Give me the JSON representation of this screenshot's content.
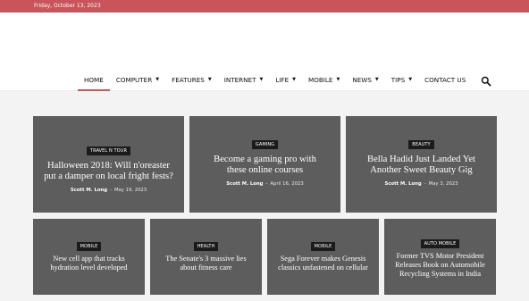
{
  "topbar": {
    "date": "Friday, October 13, 2023"
  },
  "nav": {
    "items": [
      {
        "label": "HOME",
        "active": true,
        "has_dropdown": false
      },
      {
        "label": "COMPUTER",
        "has_dropdown": true
      },
      {
        "label": "FEATURES",
        "has_dropdown": true
      },
      {
        "label": "INTERNET",
        "has_dropdown": true
      },
      {
        "label": "LIFE",
        "has_dropdown": true
      },
      {
        "label": "MOBILE",
        "has_dropdown": true
      },
      {
        "label": "NEWS",
        "has_dropdown": true
      },
      {
        "label": "TIPS",
        "has_dropdown": true
      },
      {
        "label": "CONTACT US",
        "has_dropdown": false
      }
    ],
    "search_icon": "search-icon"
  },
  "featured": [
    {
      "category": "TRAVEL N TOUR",
      "title": "Halloween 2018: Will n'oreaster put a damper on local fright fests?",
      "author": "Scott M. Long",
      "date": "May 19, 2023"
    },
    {
      "category": "GAMING",
      "title": "Become a gaming pro with these online courses",
      "author": "Scott M. Long",
      "date": "April 16, 2023"
    },
    {
      "category": "BEAUTY",
      "title": "Bella Hadid Just Landed Yet Another Sweet Beauty Gig",
      "author": "Scott M. Long",
      "date": "May 3, 2023"
    }
  ],
  "secondary": [
    {
      "category": "MOBILE",
      "title": "New cell app that tracks hydration level developed"
    },
    {
      "category": "HEALTH",
      "title": "The Senate's 3 massive lies about fitness care"
    },
    {
      "category": "MOBILE",
      "title": "Sega Forever makes Genesis classics unfastened on cellular"
    },
    {
      "category": "AUTO MOBILE",
      "title": "Former TVS Motor President Releases Book on Automobile Recycling Systems in India"
    }
  ],
  "colors": {
    "accent": "#c9545a",
    "card_bg": "#5d5d5d",
    "badge_bg": "#1b1b1b"
  }
}
